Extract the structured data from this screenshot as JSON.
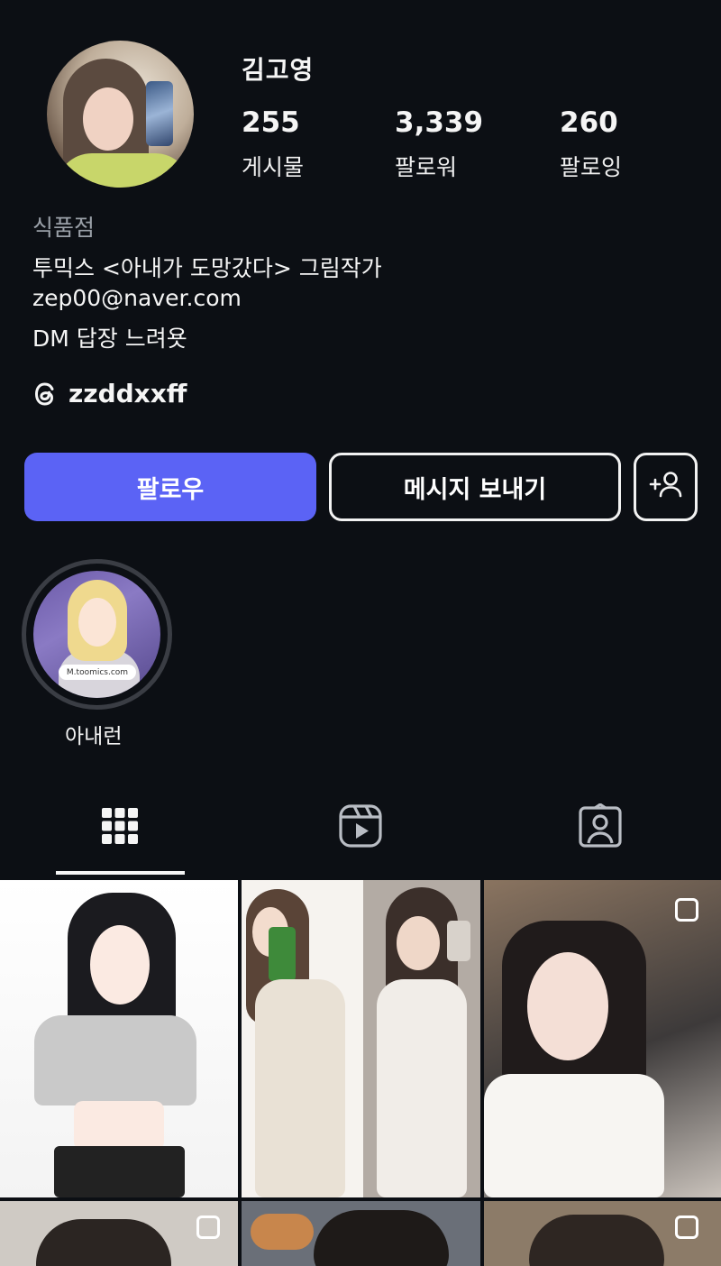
{
  "profile": {
    "username": "김고영",
    "stats": [
      {
        "value": "255",
        "label": "게시물"
      },
      {
        "value": "3,339",
        "label": "팔로워"
      },
      {
        "value": "260",
        "label": "팔로잉"
      }
    ],
    "category": "식품점",
    "bio": [
      "투믹스 <아내가 도망갔다> 그림작가",
      "zep00@naver.com",
      "DM 답장 느려욧"
    ],
    "threads_handle": "zzddxxff"
  },
  "buttons": {
    "follow": "팔로우",
    "message": "메시지 보내기",
    "add_person_icon": "add-person-icon"
  },
  "highlight": {
    "label": "아내런",
    "link_text": "M.toomics.com"
  },
  "tabs": [
    {
      "icon": "grid-icon",
      "active": true
    },
    {
      "icon": "reels-icon",
      "active": false
    },
    {
      "icon": "tagged-icon",
      "active": false
    }
  ],
  "colors": {
    "background": "#0c0f14",
    "follow_button": "#5b63f5",
    "category_text": "#9aa0a8"
  }
}
